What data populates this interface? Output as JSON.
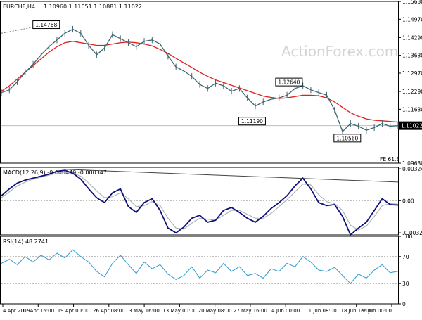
{
  "window": {
    "title": "EURCHF,H4",
    "ohlc": "1.10960 1.11051 1.10881 1.11022",
    "watermark": "ActionForex.com"
  },
  "colors": {
    "price": "#3d6670",
    "ma": "#e02020",
    "macd_main": "#10107a",
    "macd_signal": "#a9b4b8",
    "rsi": "#3aa0d0",
    "grid_axis": "#000000",
    "label_bg": "#ffffff",
    "current_price_bg": "#000000",
    "current_price_text": "#ffffff",
    "trendline": "#444444"
  },
  "chart_data": [
    {
      "type": "line",
      "name": "price-panel",
      "title": "EURCHF,H4",
      "subtitle": "1.10960 1.11051 1.10881 1.11022",
      "y_ticks": [
        "1.15630",
        "1.14970",
        "1.14290",
        "1.13630",
        "1.12970",
        "1.12290",
        "1.11630",
        "1.10970",
        "1.09630"
      ],
      "ylim": [
        1.0963,
        1.1563
      ],
      "current_price": "1.11022",
      "current_price_value": 1.11022,
      "annotations": [
        {
          "text": "1.14768",
          "x": 0.113,
          "y": 1.14768
        },
        {
          "text": "1.12640",
          "x": 0.725,
          "y": 1.1264
        },
        {
          "text": "1.11190",
          "x": 0.632,
          "y": 1.1119
        },
        {
          "text": "1.10560",
          "x": 0.872,
          "y": 1.1056
        }
      ],
      "fib_label": "FE 61.8",
      "fib_level": 1.0973,
      "x": [
        0,
        0.02,
        0.04,
        0.06,
        0.08,
        0.1,
        0.12,
        0.14,
        0.16,
        0.18,
        0.2,
        0.22,
        0.24,
        0.26,
        0.28,
        0.3,
        0.32,
        0.34,
        0.36,
        0.38,
        0.4,
        0.42,
        0.44,
        0.46,
        0.48,
        0.5,
        0.52,
        0.54,
        0.56,
        0.58,
        0.6,
        0.62,
        0.64,
        0.66,
        0.68,
        0.7,
        0.72,
        0.74,
        0.76,
        0.78,
        0.8,
        0.82,
        0.84,
        0.86,
        0.88,
        0.9,
        0.92,
        0.94,
        0.96,
        0.98,
        1.0
      ],
      "series": [
        {
          "values": [
            1.1225,
            1.1235,
            1.1265,
            1.13,
            1.133,
            1.1365,
            1.1395,
            1.142,
            1.1445,
            1.146,
            1.1445,
            1.14,
            1.1365,
            1.139,
            1.144,
            1.1425,
            1.141,
            1.1395,
            1.1415,
            1.142,
            1.1405,
            1.136,
            1.132,
            1.1305,
            1.1285,
            1.1255,
            1.124,
            1.126,
            1.125,
            1.123,
            1.124,
            1.1205,
            1.1175,
            1.119,
            1.12,
            1.1205,
            1.1215,
            1.124,
            1.125,
            1.1235,
            1.1225,
            1.1215,
            1.116,
            1.108,
            1.111,
            1.11,
            1.1085,
            1.1095,
            1.111,
            1.11,
            1.1102
          ]
        },
        {
          "values": [
            1.123,
            1.125,
            1.1275,
            1.13,
            1.1325,
            1.135,
            1.1375,
            1.1395,
            1.141,
            1.1415,
            1.141,
            1.1405,
            1.14,
            1.14,
            1.1405,
            1.141,
            1.1412,
            1.141,
            1.1405,
            1.1398,
            1.1385,
            1.137,
            1.1352,
            1.1335,
            1.1318,
            1.13,
            1.1285,
            1.1272,
            1.1262,
            1.1252,
            1.1242,
            1.1232,
            1.1222,
            1.1212,
            1.1207,
            1.1203,
            1.1205,
            1.121,
            1.1215,
            1.1215,
            1.1213,
            1.1205,
            1.119,
            1.117,
            1.115,
            1.1137,
            1.1127,
            1.1122,
            1.112,
            1.1118,
            1.1115
          ]
        }
      ]
    },
    {
      "type": "line",
      "name": "macd-panel",
      "title": "MACD(12,26,9) -0.000449 -0.000347",
      "y_ticks": [
        "0.003249",
        "0.00",
        "-0.003293"
      ],
      "ylim": [
        -0.0035,
        0.0034
      ],
      "x": [
        0,
        0.02,
        0.04,
        0.06,
        0.08,
        0.1,
        0.12,
        0.14,
        0.16,
        0.18,
        0.2,
        0.22,
        0.24,
        0.26,
        0.28,
        0.3,
        0.32,
        0.34,
        0.36,
        0.38,
        0.4,
        0.42,
        0.44,
        0.46,
        0.48,
        0.5,
        0.52,
        0.54,
        0.56,
        0.58,
        0.6,
        0.62,
        0.64,
        0.66,
        0.68,
        0.7,
        0.72,
        0.74,
        0.76,
        0.78,
        0.8,
        0.82,
        0.84,
        0.86,
        0.88,
        0.9,
        0.92,
        0.94,
        0.96,
        0.98,
        1.0
      ],
      "series": [
        {
          "values": [
            0.0005,
            0.0012,
            0.0018,
            0.0021,
            0.0023,
            0.0025,
            0.0027,
            0.003,
            0.0031,
            0.0028,
            0.0022,
            0.0012,
            0.0003,
            -0.0002,
            0.0008,
            0.0012,
            -0.0006,
            -0.0012,
            -0.0002,
            0.0002,
            -0.001,
            -0.0028,
            -0.0033,
            -0.0027,
            -0.0018,
            -0.0015,
            -0.0022,
            -0.002,
            -0.001,
            -0.0007,
            -0.0012,
            -0.0018,
            -0.0022,
            -0.0016,
            -0.0008,
            -0.0002,
            0.0005,
            0.0015,
            0.0023,
            0.0012,
            -0.0002,
            -0.0005,
            -0.0004,
            -0.0016,
            -0.0035,
            -0.0028,
            -0.0022,
            -0.001,
            0.0002,
            -0.0004,
            -0.00045
          ]
        },
        {
          "values": [
            0.0003,
            0.0009,
            0.0015,
            0.0019,
            0.0022,
            0.0024,
            0.0026,
            0.0028,
            0.0029,
            0.0028,
            0.0025,
            0.0018,
            0.001,
            0.0003,
            0.0004,
            0.0008,
            0.0002,
            -0.0006,
            -0.0005,
            -0.0001,
            -0.0005,
            -0.0018,
            -0.0028,
            -0.0029,
            -0.0023,
            -0.0018,
            -0.0019,
            -0.002,
            -0.0015,
            -0.001,
            -0.001,
            -0.0014,
            -0.0018,
            -0.0018,
            -0.0013,
            -0.0006,
            0.0001,
            0.0009,
            0.0017,
            0.0016,
            0.0006,
            -0.0001,
            -0.0003,
            -0.001,
            -0.0025,
            -0.003,
            -0.0026,
            -0.0016,
            -0.0005,
            -0.0003,
            -0.00035
          ]
        }
      ]
    },
    {
      "type": "line",
      "name": "rsi-panel",
      "title": "RSI(14) 48.2741",
      "y_ticks": [
        "100",
        "70",
        "30",
        "0"
      ],
      "ylim": [
        0,
        100
      ],
      "levels": [
        70,
        30
      ],
      "x": [
        0,
        0.02,
        0.04,
        0.06,
        0.08,
        0.1,
        0.12,
        0.14,
        0.16,
        0.18,
        0.2,
        0.22,
        0.24,
        0.26,
        0.28,
        0.3,
        0.32,
        0.34,
        0.36,
        0.38,
        0.4,
        0.42,
        0.44,
        0.46,
        0.48,
        0.5,
        0.52,
        0.54,
        0.56,
        0.58,
        0.6,
        0.62,
        0.64,
        0.66,
        0.68,
        0.7,
        0.72,
        0.74,
        0.76,
        0.78,
        0.8,
        0.82,
        0.84,
        0.86,
        0.88,
        0.9,
        0.92,
        0.94,
        0.96,
        0.98,
        1.0
      ],
      "series": [
        {
          "values": [
            60,
            66,
            58,
            70,
            62,
            72,
            65,
            75,
            68,
            80,
            70,
            62,
            48,
            40,
            60,
            72,
            58,
            45,
            62,
            52,
            58,
            44,
            36,
            42,
            55,
            38,
            50,
            46,
            60,
            48,
            55,
            42,
            45,
            38,
            52,
            48,
            60,
            55,
            70,
            62,
            50,
            48,
            54,
            42,
            30,
            44,
            38,
            50,
            58,
            46,
            48.27
          ]
        }
      ]
    },
    {
      "type": "line",
      "name": "time-axis",
      "categories": [
        "4 Apr 2019",
        "11 Apr 16:00",
        "19 Apr 00:00",
        "26 Apr 08:00",
        "3 May 16:00",
        "13 May 00:00",
        "20 May 08:00",
        "27 May 16:00",
        "4 Jun 00:00",
        "11 Jun 08:00",
        "18 Jun 16:00",
        "26 Jun 00:00"
      ]
    }
  ]
}
